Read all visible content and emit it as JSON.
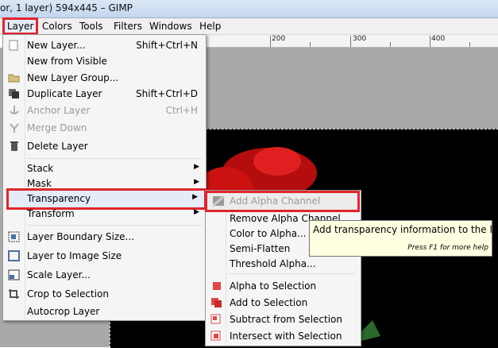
{
  "window": {
    "title": "or, 1 layer) 594x445 – GIMP"
  },
  "menubar": [
    "Layer",
    "Colors",
    "Tools",
    "Filters",
    "Windows",
    "Help"
  ],
  "ruler": [
    "200",
    "300",
    "400"
  ],
  "layer_menu": {
    "items": [
      {
        "label": "New Layer...",
        "shortcut": "Shift+Ctrl+N",
        "icon": "new-layer-icon"
      },
      {
        "label": "New from Visible",
        "shortcut": "",
        "icon": ""
      },
      {
        "label": "New Layer Group...",
        "shortcut": "",
        "icon": "folder-icon"
      },
      {
        "label": "Duplicate Layer",
        "shortcut": "Shift+Ctrl+D",
        "icon": "duplicate-icon"
      },
      {
        "label": "Anchor Layer",
        "shortcut": "Ctrl+H",
        "icon": "anchor-icon"
      },
      {
        "label": "Merge Down",
        "shortcut": "",
        "icon": "merge-icon"
      },
      {
        "label": "Delete Layer",
        "shortcut": "",
        "icon": "trash-icon"
      },
      {
        "label": "Stack",
        "shortcut": "",
        "icon": ""
      },
      {
        "label": "Mask",
        "shortcut": "",
        "icon": ""
      },
      {
        "label": "Transparency",
        "shortcut": "",
        "icon": ""
      },
      {
        "label": "Transform",
        "shortcut": "",
        "icon": ""
      },
      {
        "label": "Layer Boundary Size...",
        "shortcut": "",
        "icon": "boundary-icon"
      },
      {
        "label": "Layer to Image Size",
        "shortcut": "",
        "icon": "layer-to-image-icon"
      },
      {
        "label": "Scale Layer...",
        "shortcut": "",
        "icon": "scale-icon"
      },
      {
        "label": "Crop to Selection",
        "shortcut": "",
        "icon": "crop-icon"
      },
      {
        "label": "Autocrop Layer",
        "shortcut": "",
        "icon": ""
      }
    ]
  },
  "transparency_menu": {
    "items": [
      {
        "label": "Add Alpha Channel"
      },
      {
        "label": "Remove Alpha Channel"
      },
      {
        "label": "Color to Alpha..."
      },
      {
        "label": "Semi-Flatten"
      },
      {
        "label": "Threshold Alpha..."
      },
      {
        "label": "Alpha to Selection"
      },
      {
        "label": "Add to Selection"
      },
      {
        "label": "Subtract from Selection"
      },
      {
        "label": "Intersect with Selection"
      }
    ]
  },
  "tooltip": {
    "text": "Add transparency information to the layer",
    "hint": "Press F1 for more help"
  },
  "colors": {
    "highlight_box": "#e0252b",
    "petal_red": "#cc1111"
  }
}
